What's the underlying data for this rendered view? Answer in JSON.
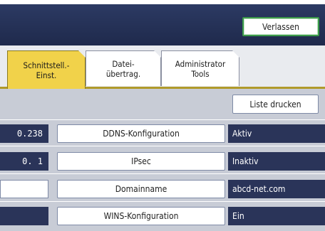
{
  "header": {
    "exit_label": "Verlassen"
  },
  "tabs": [
    {
      "line1": "Schnittstell.-",
      "line2": "Einst."
    },
    {
      "line1": "Datei-",
      "line2": "übertrag."
    },
    {
      "line1": "Administrator",
      "line2": "Tools"
    }
  ],
  "toolbar": {
    "print_list_label": "Liste drucken"
  },
  "rows": [
    {
      "left": "0.238",
      "label": "DDNS-Konfiguration",
      "value": "Aktiv"
    },
    {
      "left": "0.   1",
      "label": "IPsec",
      "value": "Inaktiv"
    },
    {
      "left": "",
      "label": "Domainname",
      "value": "abcd-net.com"
    },
    {
      "left": "",
      "label": "WINS-Konfiguration",
      "value": "Ein"
    }
  ]
}
